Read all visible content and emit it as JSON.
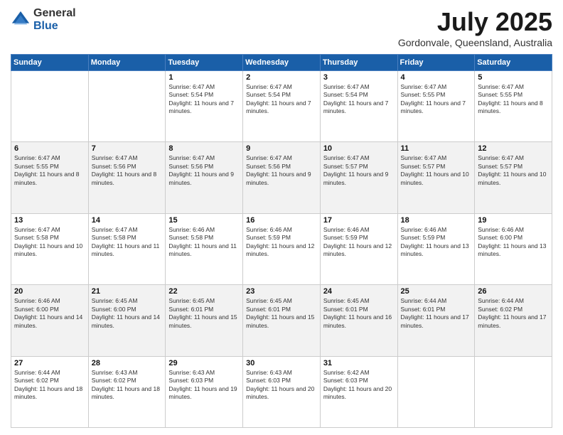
{
  "logo": {
    "general": "General",
    "blue": "Blue"
  },
  "header": {
    "title": "July 2025",
    "subtitle": "Gordonvale, Queensland, Australia"
  },
  "weekdays": [
    "Sunday",
    "Monday",
    "Tuesday",
    "Wednesday",
    "Thursday",
    "Friday",
    "Saturday"
  ],
  "weeks": [
    [
      {
        "day": "",
        "sunrise": "",
        "sunset": "",
        "daylight": ""
      },
      {
        "day": "",
        "sunrise": "",
        "sunset": "",
        "daylight": ""
      },
      {
        "day": "1",
        "sunrise": "Sunrise: 6:47 AM",
        "sunset": "Sunset: 5:54 PM",
        "daylight": "Daylight: 11 hours and 7 minutes."
      },
      {
        "day": "2",
        "sunrise": "Sunrise: 6:47 AM",
        "sunset": "Sunset: 5:54 PM",
        "daylight": "Daylight: 11 hours and 7 minutes."
      },
      {
        "day": "3",
        "sunrise": "Sunrise: 6:47 AM",
        "sunset": "Sunset: 5:54 PM",
        "daylight": "Daylight: 11 hours and 7 minutes."
      },
      {
        "day": "4",
        "sunrise": "Sunrise: 6:47 AM",
        "sunset": "Sunset: 5:55 PM",
        "daylight": "Daylight: 11 hours and 7 minutes."
      },
      {
        "day": "5",
        "sunrise": "Sunrise: 6:47 AM",
        "sunset": "Sunset: 5:55 PM",
        "daylight": "Daylight: 11 hours and 8 minutes."
      }
    ],
    [
      {
        "day": "6",
        "sunrise": "Sunrise: 6:47 AM",
        "sunset": "Sunset: 5:55 PM",
        "daylight": "Daylight: 11 hours and 8 minutes."
      },
      {
        "day": "7",
        "sunrise": "Sunrise: 6:47 AM",
        "sunset": "Sunset: 5:56 PM",
        "daylight": "Daylight: 11 hours and 8 minutes."
      },
      {
        "day": "8",
        "sunrise": "Sunrise: 6:47 AM",
        "sunset": "Sunset: 5:56 PM",
        "daylight": "Daylight: 11 hours and 9 minutes."
      },
      {
        "day": "9",
        "sunrise": "Sunrise: 6:47 AM",
        "sunset": "Sunset: 5:56 PM",
        "daylight": "Daylight: 11 hours and 9 minutes."
      },
      {
        "day": "10",
        "sunrise": "Sunrise: 6:47 AM",
        "sunset": "Sunset: 5:57 PM",
        "daylight": "Daylight: 11 hours and 9 minutes."
      },
      {
        "day": "11",
        "sunrise": "Sunrise: 6:47 AM",
        "sunset": "Sunset: 5:57 PM",
        "daylight": "Daylight: 11 hours and 10 minutes."
      },
      {
        "day": "12",
        "sunrise": "Sunrise: 6:47 AM",
        "sunset": "Sunset: 5:57 PM",
        "daylight": "Daylight: 11 hours and 10 minutes."
      }
    ],
    [
      {
        "day": "13",
        "sunrise": "Sunrise: 6:47 AM",
        "sunset": "Sunset: 5:58 PM",
        "daylight": "Daylight: 11 hours and 10 minutes."
      },
      {
        "day": "14",
        "sunrise": "Sunrise: 6:47 AM",
        "sunset": "Sunset: 5:58 PM",
        "daylight": "Daylight: 11 hours and 11 minutes."
      },
      {
        "day": "15",
        "sunrise": "Sunrise: 6:46 AM",
        "sunset": "Sunset: 5:58 PM",
        "daylight": "Daylight: 11 hours and 11 minutes."
      },
      {
        "day": "16",
        "sunrise": "Sunrise: 6:46 AM",
        "sunset": "Sunset: 5:59 PM",
        "daylight": "Daylight: 11 hours and 12 minutes."
      },
      {
        "day": "17",
        "sunrise": "Sunrise: 6:46 AM",
        "sunset": "Sunset: 5:59 PM",
        "daylight": "Daylight: 11 hours and 12 minutes."
      },
      {
        "day": "18",
        "sunrise": "Sunrise: 6:46 AM",
        "sunset": "Sunset: 5:59 PM",
        "daylight": "Daylight: 11 hours and 13 minutes."
      },
      {
        "day": "19",
        "sunrise": "Sunrise: 6:46 AM",
        "sunset": "Sunset: 6:00 PM",
        "daylight": "Daylight: 11 hours and 13 minutes."
      }
    ],
    [
      {
        "day": "20",
        "sunrise": "Sunrise: 6:46 AM",
        "sunset": "Sunset: 6:00 PM",
        "daylight": "Daylight: 11 hours and 14 minutes."
      },
      {
        "day": "21",
        "sunrise": "Sunrise: 6:45 AM",
        "sunset": "Sunset: 6:00 PM",
        "daylight": "Daylight: 11 hours and 14 minutes."
      },
      {
        "day": "22",
        "sunrise": "Sunrise: 6:45 AM",
        "sunset": "Sunset: 6:01 PM",
        "daylight": "Daylight: 11 hours and 15 minutes."
      },
      {
        "day": "23",
        "sunrise": "Sunrise: 6:45 AM",
        "sunset": "Sunset: 6:01 PM",
        "daylight": "Daylight: 11 hours and 15 minutes."
      },
      {
        "day": "24",
        "sunrise": "Sunrise: 6:45 AM",
        "sunset": "Sunset: 6:01 PM",
        "daylight": "Daylight: 11 hours and 16 minutes."
      },
      {
        "day": "25",
        "sunrise": "Sunrise: 6:44 AM",
        "sunset": "Sunset: 6:01 PM",
        "daylight": "Daylight: 11 hours and 17 minutes."
      },
      {
        "day": "26",
        "sunrise": "Sunrise: 6:44 AM",
        "sunset": "Sunset: 6:02 PM",
        "daylight": "Daylight: 11 hours and 17 minutes."
      }
    ],
    [
      {
        "day": "27",
        "sunrise": "Sunrise: 6:44 AM",
        "sunset": "Sunset: 6:02 PM",
        "daylight": "Daylight: 11 hours and 18 minutes."
      },
      {
        "day": "28",
        "sunrise": "Sunrise: 6:43 AM",
        "sunset": "Sunset: 6:02 PM",
        "daylight": "Daylight: 11 hours and 18 minutes."
      },
      {
        "day": "29",
        "sunrise": "Sunrise: 6:43 AM",
        "sunset": "Sunset: 6:03 PM",
        "daylight": "Daylight: 11 hours and 19 minutes."
      },
      {
        "day": "30",
        "sunrise": "Sunrise: 6:43 AM",
        "sunset": "Sunset: 6:03 PM",
        "daylight": "Daylight: 11 hours and 20 minutes."
      },
      {
        "day": "31",
        "sunrise": "Sunrise: 6:42 AM",
        "sunset": "Sunset: 6:03 PM",
        "daylight": "Daylight: 11 hours and 20 minutes."
      },
      {
        "day": "",
        "sunrise": "",
        "sunset": "",
        "daylight": ""
      },
      {
        "day": "",
        "sunrise": "",
        "sunset": "",
        "daylight": ""
      }
    ]
  ]
}
